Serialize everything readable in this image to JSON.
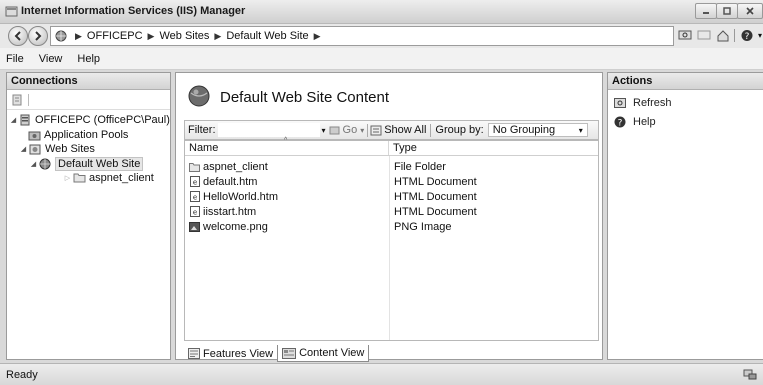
{
  "window": {
    "title": "Internet Information Services (IIS) Manager"
  },
  "address": {
    "breadcrumbs": [
      "OFFICEPC",
      "Web Sites",
      "Default Web Site"
    ]
  },
  "menu": [
    "File",
    "View",
    "Help"
  ],
  "connections": {
    "header": "Connections",
    "tree": [
      {
        "label": "OFFICEPC (OfficePC\\Paul)",
        "icon": "server-icon"
      },
      {
        "label": "Application Pools",
        "icon": "app-pool-icon"
      },
      {
        "label": "Web Sites",
        "icon": "sites-folder-icon"
      },
      {
        "label": "Default Web Site",
        "icon": "globe-icon"
      },
      {
        "label": "aspnet_client",
        "icon": "folder-icon"
      }
    ]
  },
  "content": {
    "title": "Default Web Site Content",
    "filter_label": "Filter:",
    "go_label": "Go",
    "show_all_label": "Show All",
    "group_by_label": "Group by:",
    "group_by_value": "No Grouping",
    "columns": {
      "name": "Name",
      "type": "Type"
    },
    "rows": [
      {
        "name": "aspnet_client",
        "type": "File Folder",
        "icon": "folder-icon"
      },
      {
        "name": "default.htm",
        "type": "HTML Document",
        "icon": "html-file-icon"
      },
      {
        "name": "HelloWorld.htm",
        "type": "HTML Document",
        "icon": "html-file-icon"
      },
      {
        "name": "iisstart.htm",
        "type": "HTML Document",
        "icon": "html-file-icon"
      },
      {
        "name": "welcome.png",
        "type": "PNG Image",
        "icon": "image-file-icon"
      }
    ],
    "tabs": {
      "features": "Features View",
      "content": "Content View"
    }
  },
  "actions": {
    "header": "Actions",
    "items": [
      {
        "label": "Refresh",
        "icon": "refresh-icon"
      },
      {
        "label": "Help",
        "icon": "help-icon"
      }
    ]
  },
  "status": {
    "text": "Ready"
  }
}
